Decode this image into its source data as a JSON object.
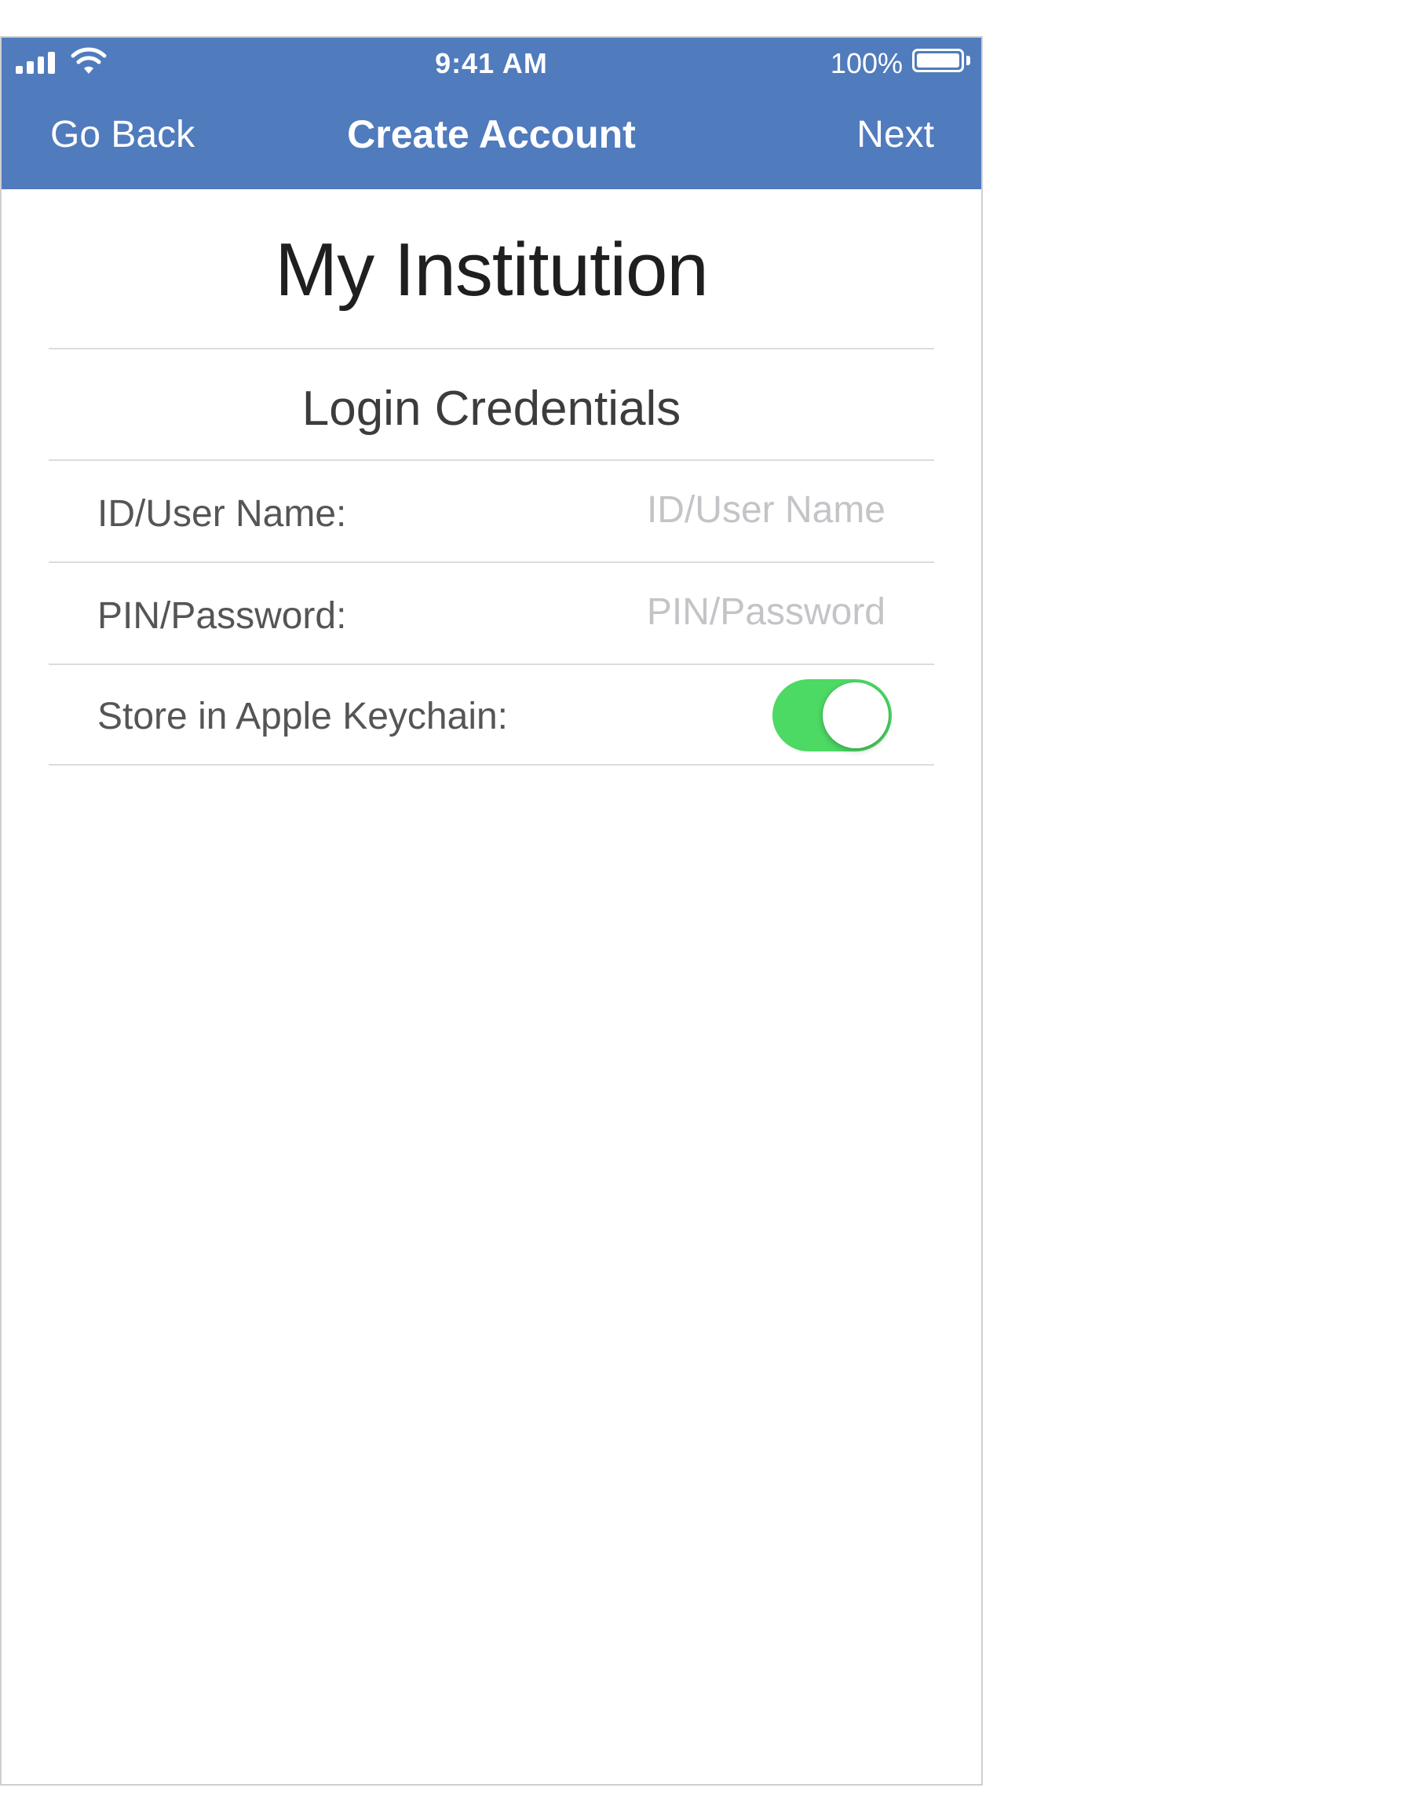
{
  "status_bar": {
    "time": "9:41 AM",
    "battery_percent": "100%",
    "battery_level": 1.0,
    "signal_icon": "cellular-signal-icon",
    "wifi_icon": "wifi-icon",
    "battery_icon": "battery-icon"
  },
  "nav_bar": {
    "back_label": "Go Back",
    "title": "Create Account",
    "next_label": "Next",
    "background_color": "#507bbd"
  },
  "institution": {
    "name": "My Institution"
  },
  "credentials": {
    "section_title": "Login Credentials",
    "username": {
      "label": "ID/User Name:",
      "placeholder": "ID/User Name",
      "value": ""
    },
    "password": {
      "label": "PIN/Password:",
      "placeholder": "PIN/Password",
      "value": ""
    },
    "keychain": {
      "label": "Store in Apple Keychain:",
      "enabled": true,
      "toggle_color": "#4cd964"
    }
  }
}
